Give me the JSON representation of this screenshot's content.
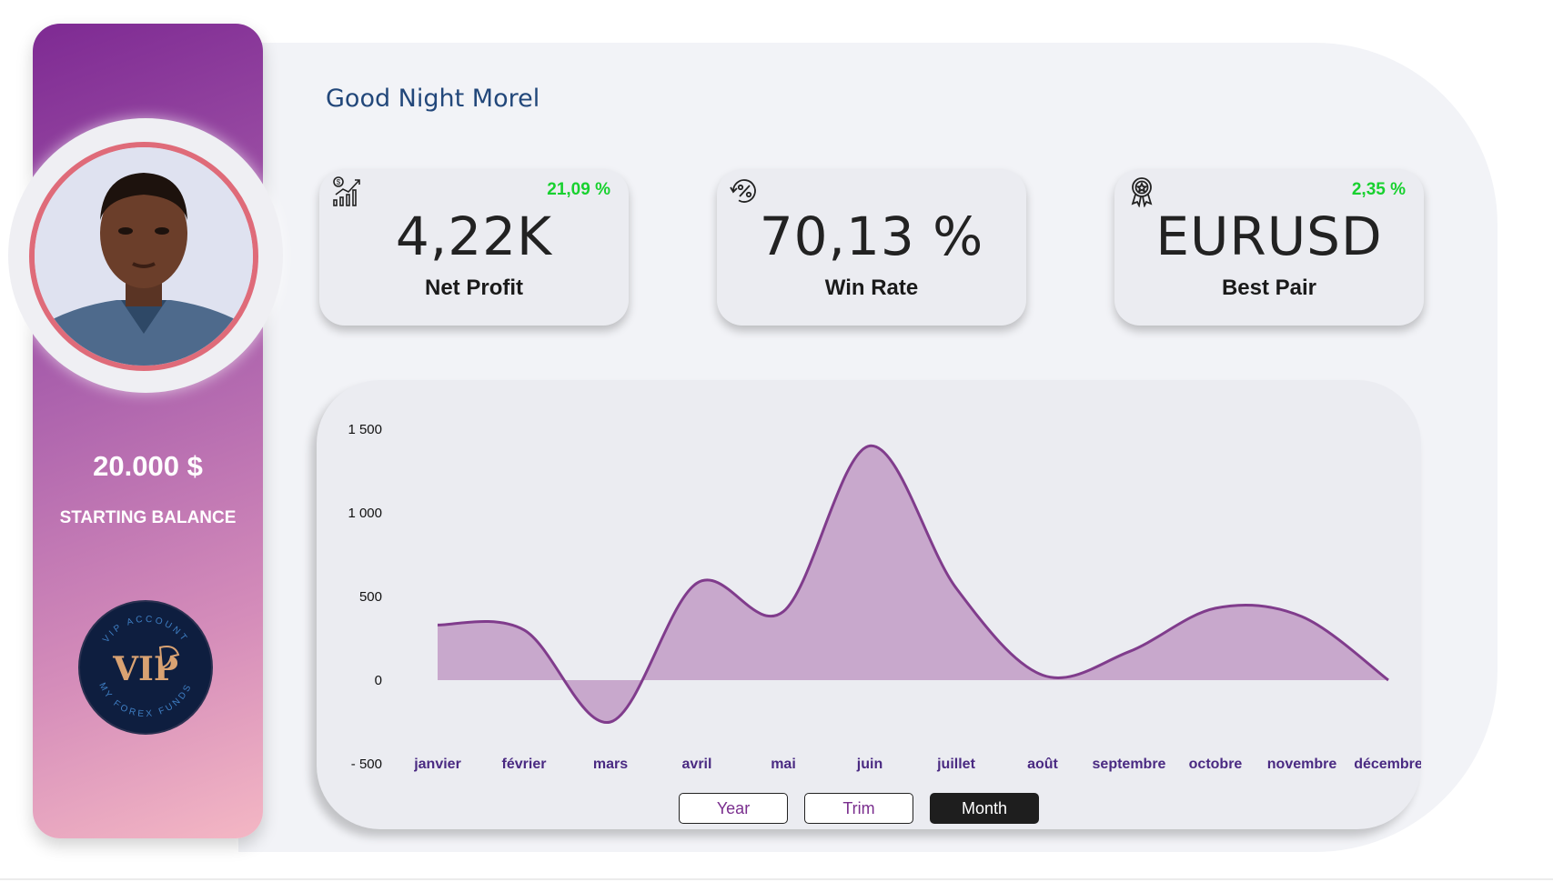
{
  "sidebar": {
    "balance_value": "20.000 $",
    "balance_label": "STARTING BALANCE",
    "badge": {
      "top_text": "VIP ACCOUNT",
      "bottom_text": "MY FOREX FUNDS",
      "logo_text": "VIP"
    }
  },
  "header": {
    "greeting": "Good Night Morel"
  },
  "kpis": [
    {
      "icon": "financial-growth-icon",
      "value": "4,22K",
      "label": "Net Profit",
      "change": "21,09 %"
    },
    {
      "icon": "percent-cycle-icon",
      "value": "70,13 %",
      "label": "Win Rate",
      "change": ""
    },
    {
      "icon": "award-badge-icon",
      "value": "EURUSD",
      "label": "Best Pair",
      "change": "2,35 %"
    }
  ],
  "colors": {
    "accent_purple": "#7e2a93",
    "area_fill": "#c8a8cc",
    "line": "#803c8c",
    "positive": "#18d12f",
    "greeting": "#22477a"
  },
  "chart_data": {
    "type": "area",
    "categories": [
      "janvier",
      "février",
      "mars",
      "avril",
      "mai",
      "juin",
      "juillet",
      "août",
      "septembre",
      "octobre",
      "novembre",
      "décembre"
    ],
    "values": [
      330,
      300,
      -250,
      580,
      410,
      1400,
      550,
      30,
      170,
      430,
      380,
      0
    ],
    "ylim": [
      -500,
      1500
    ],
    "yticks": [
      1500,
      1000,
      500,
      0,
      -500
    ],
    "ytick_labels": [
      "1 500",
      "1 000",
      "500",
      "0",
      "- 500"
    ],
    "title": "",
    "xlabel": "",
    "ylabel": "",
    "grid": false
  },
  "time_filter": {
    "options": [
      "Year",
      "Trim",
      "Month"
    ],
    "selected": "Month"
  }
}
